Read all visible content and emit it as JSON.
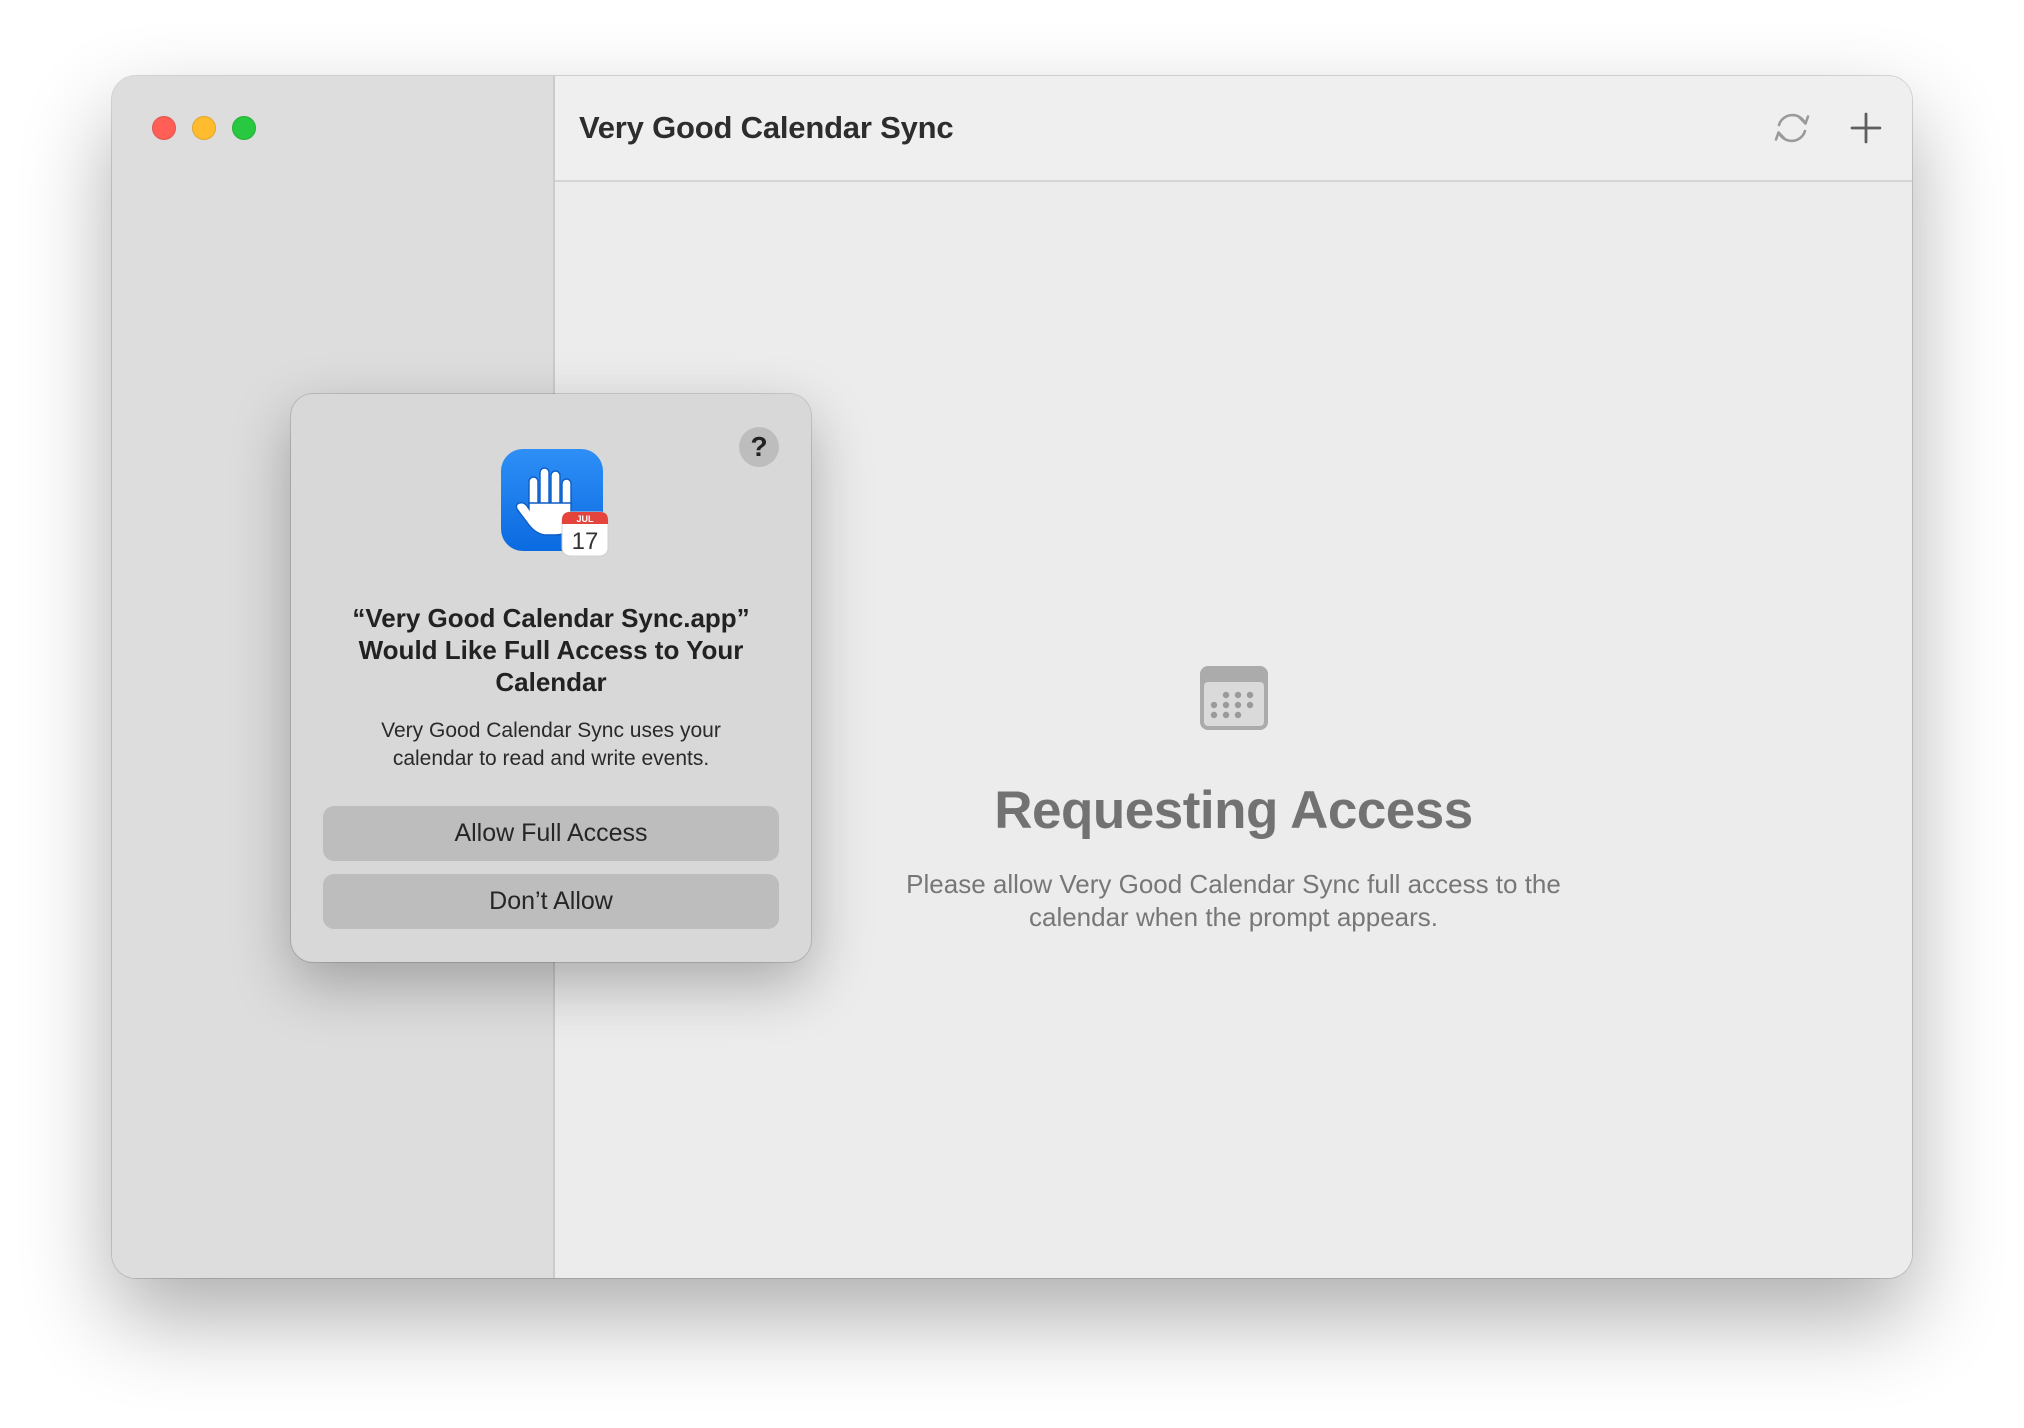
{
  "window": {
    "title": "Very Good Calendar Sync",
    "toolbar": {
      "sync_icon": "arrow-sync-icon",
      "add_icon": "plus-icon"
    }
  },
  "main": {
    "icon": "calendar-icon",
    "heading": "Requesting Access",
    "description_lines": [
      "Please allow Very Good Calendar Sync full access to the",
      "calendar when the prompt appears."
    ]
  },
  "dialog": {
    "help_label": "?",
    "app_icon": "hand-raised-calendar-icon",
    "badge_month": "JUL",
    "badge_day": "17",
    "title_lines": [
      "“Very Good Calendar Sync.app”",
      "Would Like Full Access to Your",
      "Calendar"
    ],
    "message_lines": [
      "Very Good Calendar Sync uses your",
      "calendar to read and write events."
    ],
    "allow_label": "Allow Full Access",
    "deny_label": "Don’t Allow"
  },
  "colors": {
    "close": "#ff5f57",
    "minimize": "#febc2e",
    "zoom": "#28c840",
    "app_icon_blue": "#1a7cf2",
    "calendar_badge_red": "#e5443d"
  }
}
